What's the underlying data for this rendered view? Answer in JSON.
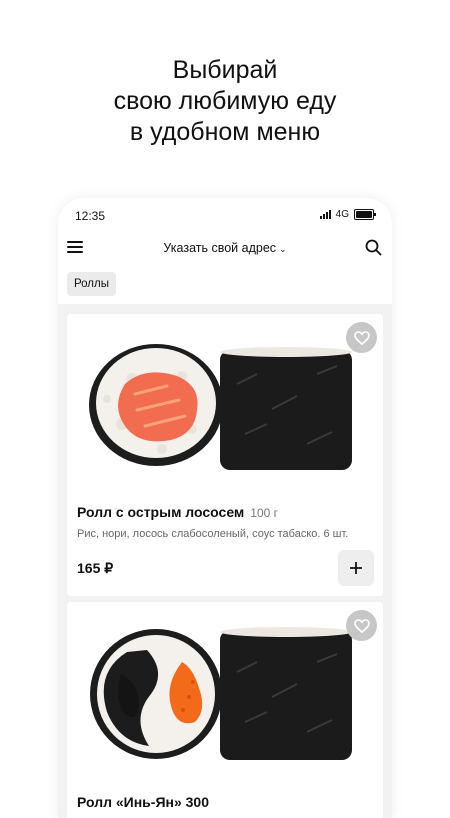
{
  "promo": {
    "line1": "Выбирай",
    "line2": "свою любимую еду",
    "line3": "в удобном меню"
  },
  "status_bar": {
    "time": "12:35",
    "network": "4G",
    "icons": [
      "signal-icon",
      "battery-icon"
    ]
  },
  "header": {
    "address_label": "Указать свой адрес",
    "icons": [
      "menu-icon",
      "chevron-down-icon",
      "search-icon"
    ]
  },
  "category": {
    "active": "Роллы"
  },
  "products": [
    {
      "name": "Ролл с острым лососем",
      "weight": "100 г",
      "description": "Рис, нори, лосось слабосоленый, соус табаско. 6 шт.",
      "price": "165 ₽",
      "add_label": "+"
    },
    {
      "name": "Ролл «Инь-Ян» 300"
    }
  ],
  "colors": {
    "background": "#ffffff",
    "feed_background": "#f2f2f2",
    "favorite_button": "#c7c7c7",
    "add_button": "#eeeeee"
  }
}
